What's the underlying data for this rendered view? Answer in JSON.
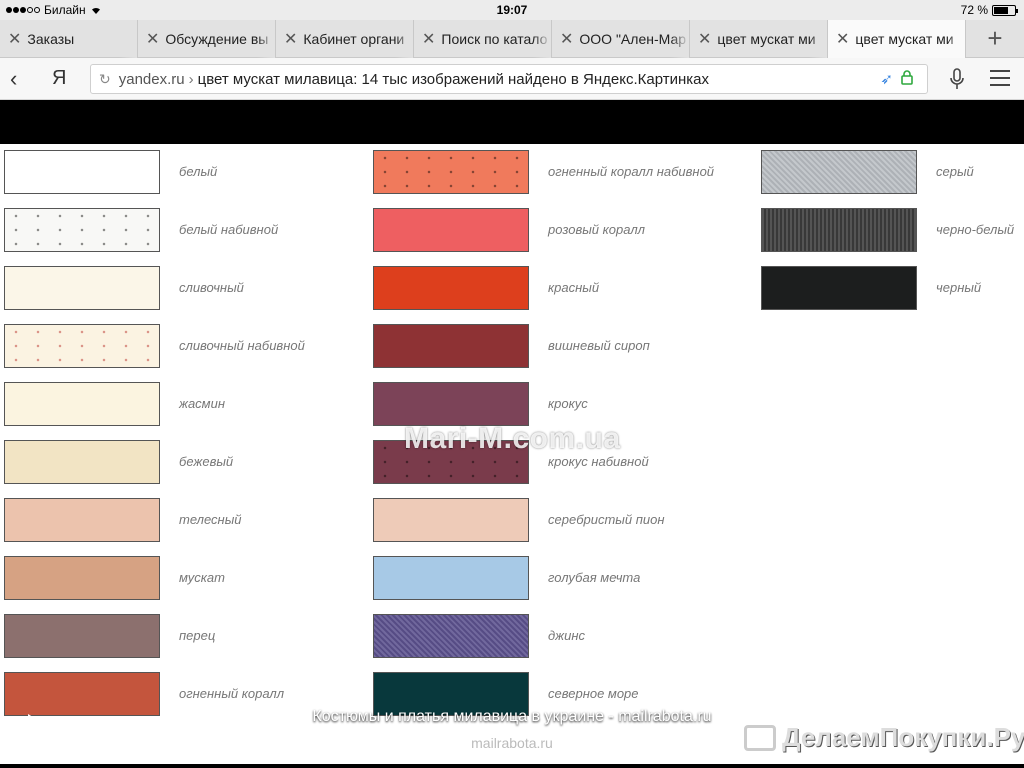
{
  "status": {
    "carrier": "Билайн",
    "time": "19:07",
    "battery": "72 %",
    "battery_level": 0.72
  },
  "tabs": [
    {
      "label": "Заказы",
      "active": false,
      "closable": false
    },
    {
      "label": "Обсуждение вы",
      "active": false,
      "closable": true
    },
    {
      "label": "Кабинет органи",
      "active": false,
      "closable": true
    },
    {
      "label": "Поиск по катало",
      "active": false,
      "closable": true
    },
    {
      "label": "ООО \"Ален-Мар",
      "active": false,
      "closable": true
    },
    {
      "label": "цвет мускат ми",
      "active": false,
      "closable": true
    },
    {
      "label": "цвет мускат ми",
      "active": true,
      "closable": true
    }
  ],
  "tab_add": "+",
  "nav": {
    "back": "‹",
    "yandex": "Я"
  },
  "url": {
    "domain": "yandex.ru",
    "separator": "›",
    "title": "цвет мускат милавица: 14 тыс изображений найдено в Яндекс.Картинках"
  },
  "photo": {
    "watermark": "Mari-M.com.ua",
    "swatches": [
      {
        "label": "белый",
        "color": "#ffffff",
        "pattern": "none"
      },
      {
        "label": "белый набивной",
        "color": "#f8f8f6",
        "pattern": "dots"
      },
      {
        "label": "сливочный",
        "color": "#fbf6e8",
        "pattern": "none"
      },
      {
        "label": "сливочный набивной",
        "color": "#fbf3e2",
        "pattern": "dots-pink"
      },
      {
        "label": "жасмин",
        "color": "#fbf4e0",
        "pattern": "none"
      },
      {
        "label": "бежевый",
        "color": "#f2e4c4",
        "pattern": "none"
      },
      {
        "label": "телесный",
        "color": "#ecc3ad",
        "pattern": "none"
      },
      {
        "label": "мускат",
        "color": "#d6a283",
        "pattern": "none"
      },
      {
        "label": "перец",
        "color": "#8c706e",
        "pattern": "none"
      },
      {
        "label": "огненный коралл",
        "color": "#c4553d",
        "pattern": "none"
      },
      {
        "label": "огненный коралл набивной",
        "color": "#f07a5c",
        "pattern": "dots"
      },
      {
        "label": "розовый коралл",
        "color": "#ee5f61",
        "pattern": "none"
      },
      {
        "label": "красный",
        "color": "#dd3f1d",
        "pattern": "none"
      },
      {
        "label": "вишневый сироп",
        "color": "#8e3234",
        "pattern": "none"
      },
      {
        "label": "крокус",
        "color": "#7c4358",
        "pattern": "none"
      },
      {
        "label": "крокус набивной",
        "color": "#7a3b4b",
        "pattern": "dots"
      },
      {
        "label": "серебристый пион",
        "color": "#eecbb8",
        "pattern": "none"
      },
      {
        "label": "голубая мечта",
        "color": "#a7c9e6",
        "pattern": "none"
      },
      {
        "label": "джинс",
        "color": "#5d5390",
        "pattern": "noise"
      },
      {
        "label": "северное море",
        "color": "#08383c",
        "pattern": "none"
      },
      {
        "label": "серый",
        "color": "#bcc0c5",
        "pattern": "noise"
      },
      {
        "label": "черно-белый",
        "color": "#9a9a9a",
        "pattern": "weave"
      },
      {
        "label": "черный",
        "color": "#1c1e1e",
        "pattern": "none"
      }
    ]
  },
  "caption": {
    "title": "Костюмы и платья милавица в украине - mailrabota.ru",
    "source": "mailrabota.ru",
    "brand": "ДелаемПокупки.Ру"
  }
}
